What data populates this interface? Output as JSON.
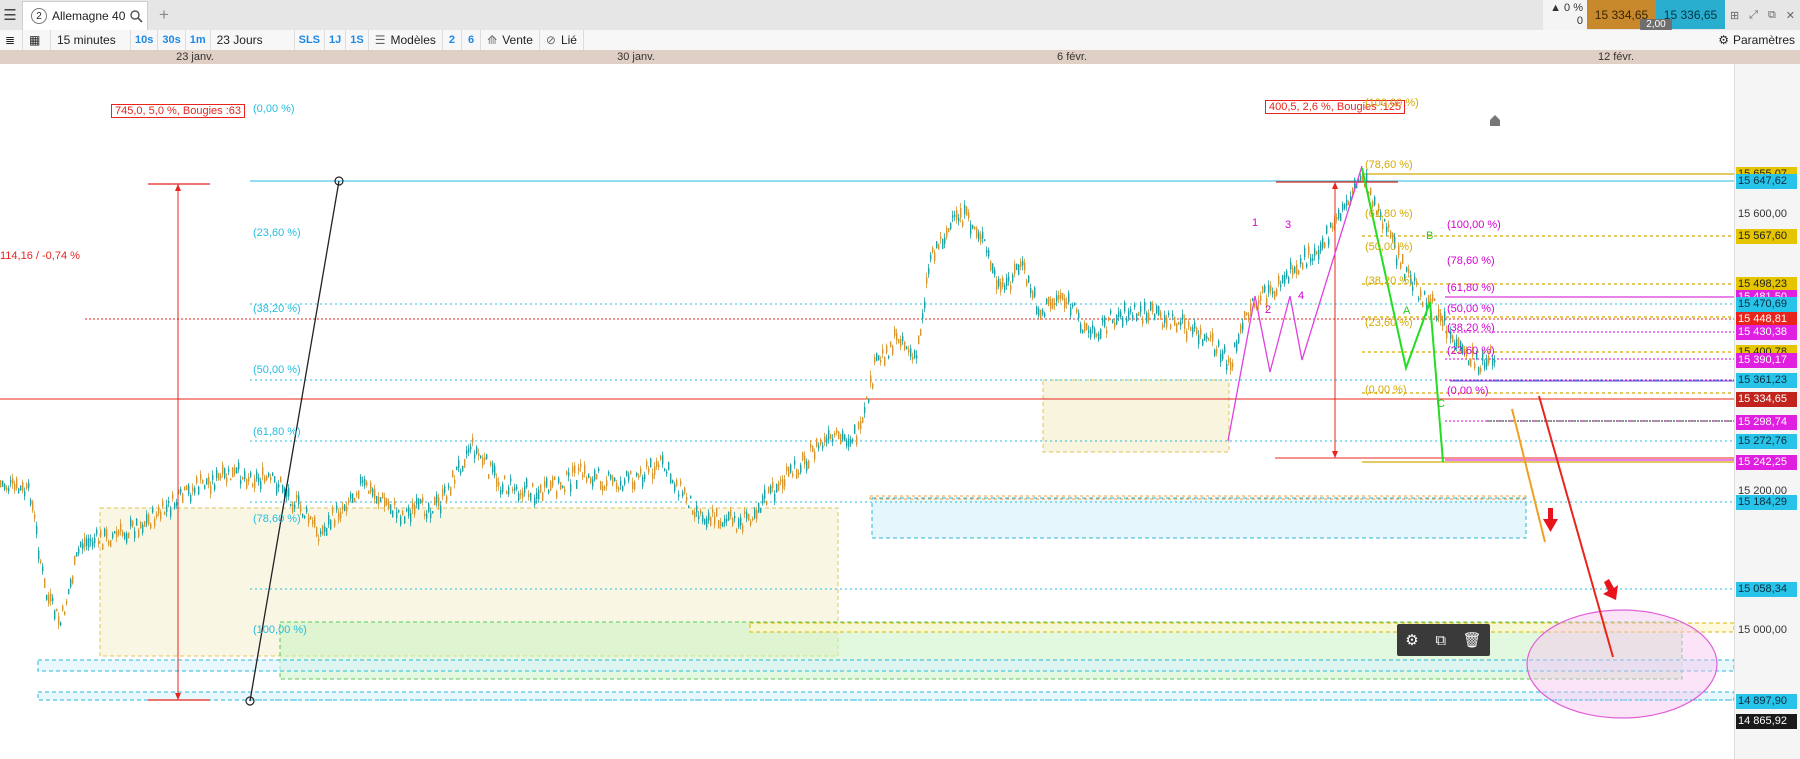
{
  "tabbar": {
    "menu_icon": "hamburger-menu-icon",
    "tab_index": "2",
    "tab_title": "Allemagne 40",
    "search_icon": "search-icon",
    "add_icon": "+",
    "variation_pct": "▲ 0 %",
    "variation_abs": "0",
    "bid": "15 334,65",
    "ask": "15 336,65",
    "spread": "2,00",
    "window_icons": [
      "grid-icon",
      "expand-icon",
      "external-window-icon",
      "close-icon"
    ]
  },
  "toolbar": {
    "list_icon": "list-icon",
    "layout_icon": "layout-icon",
    "timeframe": "15 minutes",
    "quick_timeframes": [
      "10s",
      "30s",
      "1m"
    ],
    "period": "23 Jours",
    "quick_periods": [
      "SLS",
      "1J",
      "1S"
    ],
    "models_label": "Modèles",
    "numbers": [
      "2",
      "6"
    ],
    "sell_label": "Vente",
    "linked_label": "Lié",
    "settings_label": "Paramètres"
  },
  "date_axis": [
    "23 janv.",
    "30 janv.",
    "6 févr.",
    "12 févr."
  ],
  "chart": {
    "measure_left": "745,0, 5,0 %, Bougies :63",
    "measure_right": "400,5, 2,6 %, Bougies :125",
    "left_change": "114,16 / -0,74 %",
    "fib_left": [
      "(0,00 %)",
      "(23,60 %)",
      "(38,20 %)",
      "(50,00 %)",
      "(61,80 %)",
      "(78,60 %)",
      "(100,00 %)"
    ],
    "fib_orange": [
      "(100,00 %)",
      "(78,60 %)",
      "(61,80 %)",
      "(50,00 %)",
      "(38,20 %)",
      "(23,60 %)",
      "(0,00 %)"
    ],
    "fib_pink": [
      "(100,00 %)",
      "(78,60 %)",
      "(61,80 %)",
      "(50,00 %)",
      "(38,20 %)",
      "(23,60 %)",
      "(0,00 %)"
    ],
    "wave_labels": [
      "1",
      "2",
      "3",
      "4",
      "A",
      "B",
      "C"
    ],
    "widget_icons": [
      "gear-icon",
      "copy-icon",
      "trash-icon"
    ]
  },
  "price_axis": [
    {
      "text": "15 655,07",
      "bg": "#e5c400",
      "fg": "#222"
    },
    {
      "text": "15 647,62",
      "bg": "#27c3e8",
      "fg": "#0b2d40"
    },
    {
      "text": "15 600,00",
      "bg": "",
      "fg": "#333"
    },
    {
      "text": "15 567,60",
      "bg": "#e5c400",
      "fg": "#222"
    },
    {
      "text": "15 498,23",
      "bg": "#e5c400",
      "fg": "#222"
    },
    {
      "text": "15 481,50",
      "bg": "#e020e0",
      "fg": "#fff"
    },
    {
      "text": "15 470,69",
      "bg": "#27c3e8",
      "fg": "#0b2d40"
    },
    {
      "text": "15 448,81",
      "bg": "#e8241c",
      "fg": "#fff"
    },
    {
      "text": "15 430,38",
      "bg": "#e020e0",
      "fg": "#fff"
    },
    {
      "text": "15 400,78",
      "bg": "#e5c400",
      "fg": "#222"
    },
    {
      "text": "15 390,17",
      "bg": "#e020e0",
      "fg": "#fff"
    },
    {
      "text": "15 361,23",
      "bg": "#27c3e8",
      "fg": "#0b2d40"
    },
    {
      "text": "15 334,65",
      "bg": "#c0241c",
      "fg": "#fff"
    },
    {
      "text": "15 298,74",
      "bg": "#e020e0",
      "fg": "#fff"
    },
    {
      "text": "15 272,76",
      "bg": "#27c3e8",
      "fg": "#0b2d40"
    },
    {
      "text": "15 242,25",
      "bg": "#e020e0",
      "fg": "#fff"
    },
    {
      "text": "15 200,00",
      "bg": "",
      "fg": "#333"
    },
    {
      "text": "15 184,29",
      "bg": "#27c3e8",
      "fg": "#0b2d40"
    },
    {
      "text": "15 058,34",
      "bg": "#27c3e8",
      "fg": "#0b2d40"
    },
    {
      "text": "15 000,00",
      "bg": "",
      "fg": "#333"
    },
    {
      "text": "14 897,90",
      "bg": "#27c3e8",
      "fg": "#0b2d40"
    },
    {
      "text": "14 865,92",
      "bg": "#1a1a1a",
      "fg": "#fff"
    }
  ],
  "colors": {
    "bull": "#19a3a8",
    "bear": "#d8962c",
    "fib_left": "#26bde0",
    "fib_orange": "#d4aa00",
    "fib_pink": "#d600d6",
    "current_price": "#e8241c"
  }
}
